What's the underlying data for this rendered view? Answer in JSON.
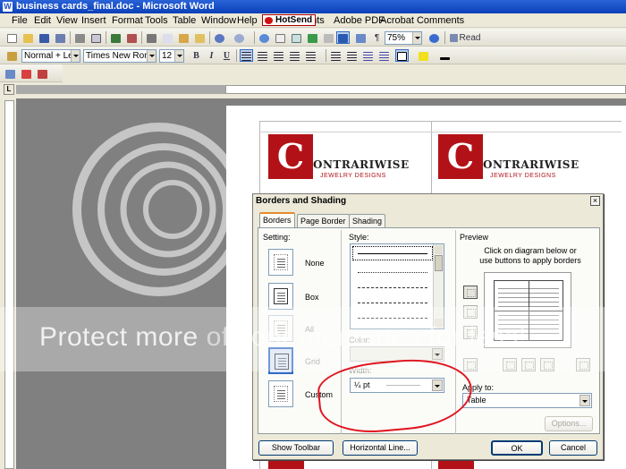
{
  "window": {
    "title": "business cards_final.doc - Microsoft Word",
    "app_icon": "W"
  },
  "menu": {
    "items": [
      "File",
      "Edit",
      "View",
      "Insert",
      "Format",
      "Tools",
      "Table",
      "Window",
      "Help",
      "ents",
      "Adobe PDF",
      "Acrobat Comments"
    ],
    "hotsend": "HotSend"
  },
  "toolbar": {
    "zoom": "75%",
    "read_label": "Read",
    "style": "Normal + Left:",
    "font": "Times New Roman",
    "size": "12",
    "bold": "B",
    "italic": "I",
    "underline": "U",
    "pilcrow": "¶"
  },
  "document": {
    "cards": [
      {
        "logo_letter": "C",
        "brand": "ONTRARIWISE",
        "tagline": "JEWELRY DESIGNS"
      },
      {
        "logo_letter": "C",
        "brand": "ONTRARIWISE",
        "tagline": "JEWELRY DESIGNS"
      }
    ]
  },
  "dialog": {
    "title": "Borders and Shading",
    "close": "×",
    "tabs": [
      "Borders",
      "Page Border",
      "Shading"
    ],
    "setting_label": "Setting:",
    "settings": [
      "None",
      "Box",
      "All",
      "Grid",
      "Custom"
    ],
    "style_label": "Style:",
    "color_label": "Color:",
    "color_value": "",
    "width_label": "Width:",
    "width_value": "¼ pt",
    "preview_label": "Preview",
    "preview_hint": "Click on diagram below or use buttons to apply borders",
    "apply_to_label": "Apply to:",
    "apply_to_value": "Table",
    "options_button": "Options...",
    "show_toolbar_button": "Show Toolbar",
    "horizontal_line_button": "Horizontal Line...",
    "ok_button": "OK",
    "cancel_button": "Cancel"
  },
  "watermark": {
    "text_main": "Protect more",
    "text_sub": " of your memories for less!",
    "brand": "photobucket"
  },
  "colors": {
    "titlebar": "#0a3fb8",
    "logo_red": "#b21217",
    "annotation": "#e0141e",
    "workspace": "#808080"
  }
}
